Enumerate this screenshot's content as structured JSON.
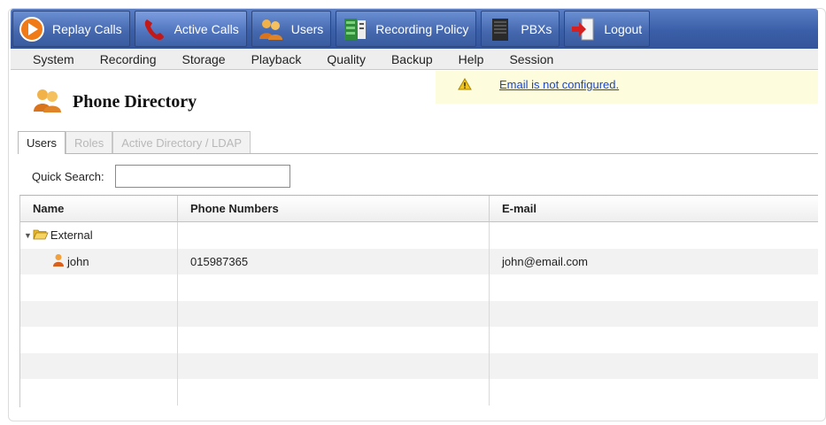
{
  "toolbar": {
    "buttons": [
      {
        "label": "Replay Calls",
        "icon": "play-icon"
      },
      {
        "label": "Active Calls",
        "icon": "phone-handset-icon"
      },
      {
        "label": "Users",
        "icon": "users-icon"
      },
      {
        "label": "Recording Policy",
        "icon": "recording-policy-icon"
      },
      {
        "label": "PBXs",
        "icon": "pbx-icon"
      },
      {
        "label": "Logout",
        "icon": "logout-door-icon"
      }
    ]
  },
  "menu": {
    "items": [
      "System",
      "Recording",
      "Storage",
      "Playback",
      "Quality",
      "Backup",
      "Help",
      "Session"
    ]
  },
  "notice": {
    "icon": "warning-icon",
    "link_text": "Email is not configured."
  },
  "page": {
    "title": "Phone Directory",
    "icon": "users-icon"
  },
  "tabs": [
    "Users",
    "Roles",
    "Active Directory / LDAP"
  ],
  "search": {
    "label": "Quick Search:",
    "value": "",
    "placeholder": ""
  },
  "grid": {
    "columns": [
      "Name",
      "Phone Numbers",
      "E-mail"
    ],
    "group": {
      "name": "External",
      "expanded": true,
      "icon": "folder-open-icon"
    },
    "rows": [
      {
        "name": "john",
        "phone": "015987365",
        "email": "john@email.com",
        "icon": "user-icon"
      }
    ]
  },
  "colors": {
    "toolbar": "#3b5fa8",
    "menubar": "#eeeeee",
    "notice": "#fdfcdc",
    "link": "#1a44cc"
  }
}
